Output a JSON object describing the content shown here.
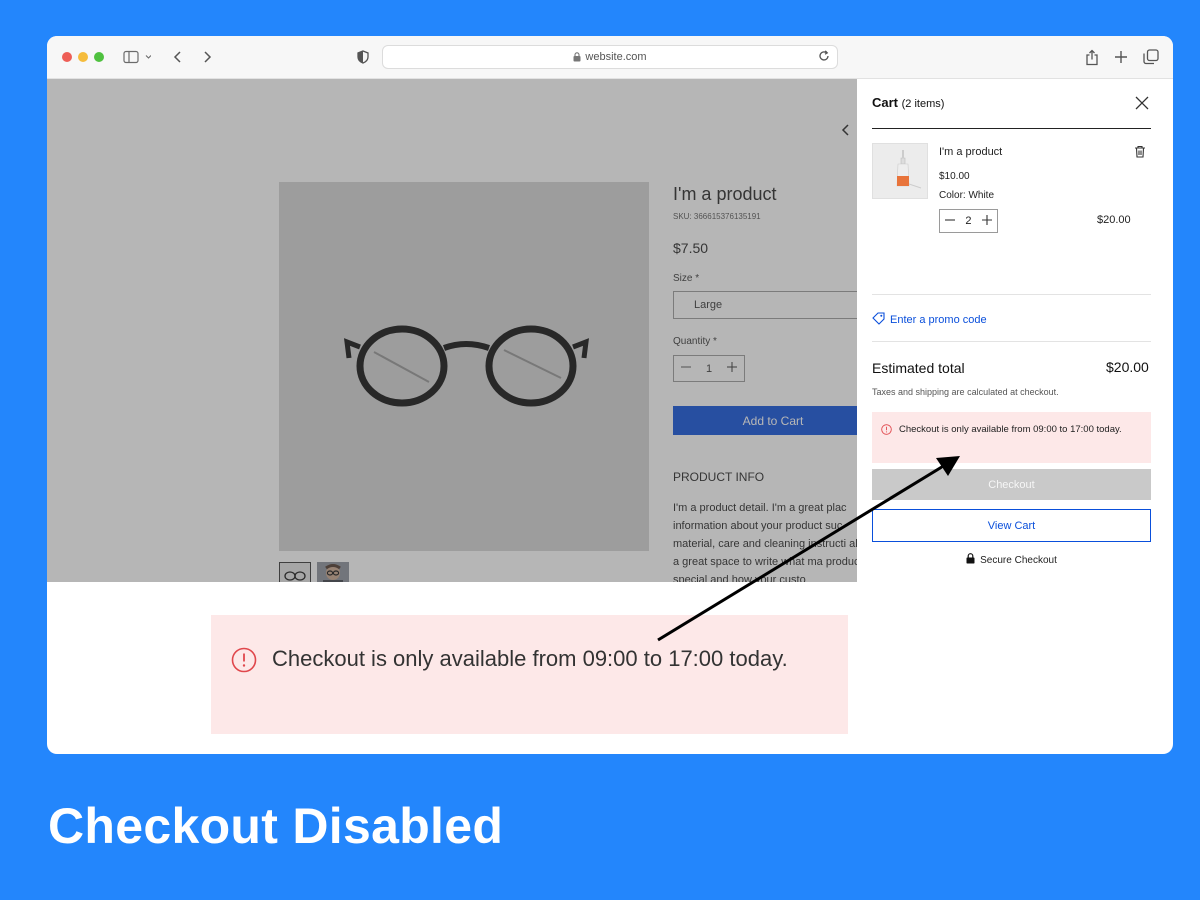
{
  "browser": {
    "url": "website.com"
  },
  "product": {
    "title": "I'm a product",
    "sku": "SKU: 366615376135191",
    "price": "$7.50",
    "size_label": "Size *",
    "size_value": "Large",
    "quantity_label": "Quantity *",
    "quantity_value": "1",
    "add_to_cart": "Add to Cart",
    "info_title": "PRODUCT INFO",
    "info_text": "I'm a product detail. I'm a great plac information about your product suc material, care and cleaning instructi also a great space to write what ma product special and how your custo"
  },
  "cart": {
    "title": "Cart",
    "count": "(2 items)",
    "item": {
      "name": "I'm a product",
      "price": "$10.00",
      "color": "Color: White",
      "quantity": "2",
      "total": "$20.00"
    },
    "promo": "Enter a promo code",
    "estimated_label": "Estimated total",
    "estimated_value": "$20.00",
    "tax_note": "Taxes and shipping are calculated at checkout.",
    "alert": "Checkout is only available from 09:00 to 17:00 today.",
    "checkout": "Checkout",
    "view_cart": "View Cart",
    "secure": "Secure Checkout"
  },
  "callout": {
    "text": "Checkout is only available from 09:00 to 17:00 today."
  },
  "caption": "Checkout Disabled",
  "colors": {
    "background": "#2386fc",
    "primary_button": "#0a4fdb",
    "alert_bg": "#fde8e8",
    "alert_icon": "#e0474c",
    "disabled_button": "#c9c9c9"
  }
}
